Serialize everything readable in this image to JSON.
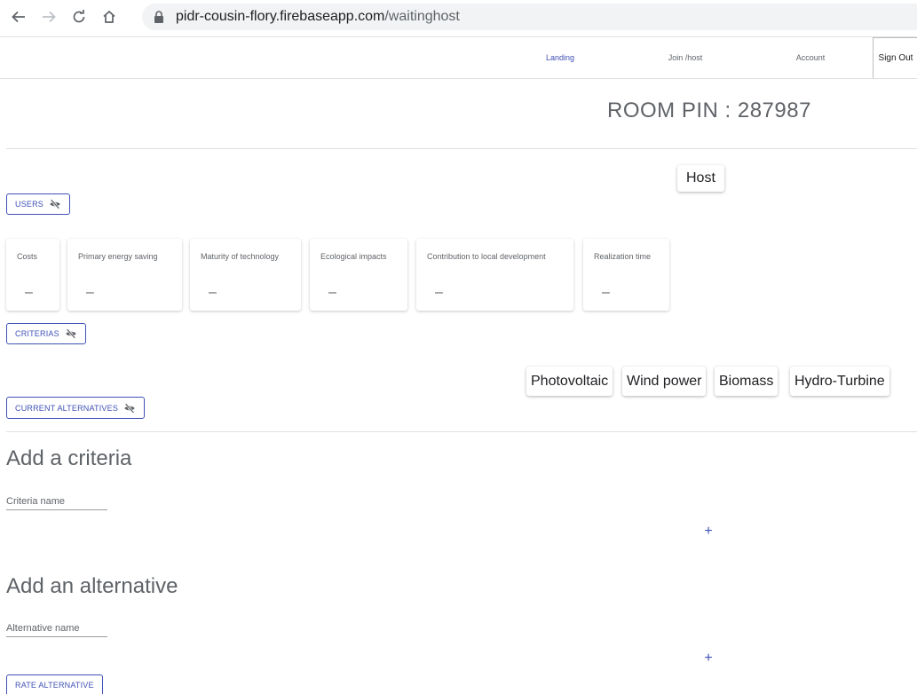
{
  "browser": {
    "url_host": "pidr-cousin-flory.firebaseapp.com",
    "url_path": "/waitinghost"
  },
  "nav": {
    "landing": "Landing",
    "join_host": "Join /host",
    "account": "Account",
    "sign_out": "Sign Out"
  },
  "room_pin": "ROOM PIN : 287987",
  "host_chip": "Host",
  "users_button": "USERS",
  "criteria_cards": [
    {
      "title": "Costs",
      "value": "–"
    },
    {
      "title": "Primary energy saving",
      "value": "–"
    },
    {
      "title": "Maturity of technology",
      "value": "–"
    },
    {
      "title": "Ecological impacts",
      "value": "–"
    },
    {
      "title": "Contribution to local development",
      "value": "–"
    },
    {
      "title": "Realization time",
      "value": "–"
    }
  ],
  "criterias_button": "CRITERIAS",
  "alternatives": [
    "Photovoltaic",
    "Wind power",
    "Biomass",
    "Hydro-Turbine"
  ],
  "current_alternatives_button": "CURRENT ALTERNATIVES",
  "add_criteria": {
    "title": "Add a criteria",
    "placeholder": "Criteria name",
    "add_symbol": "+"
  },
  "add_alternative": {
    "title": "Add an alternative",
    "placeholder": "Alternative name",
    "add_symbol": "+"
  },
  "rate_button": "RATE ALTERNATIVE",
  "colors": {
    "accent": "#3f51b5",
    "text_muted": "#5f6368",
    "divider": "#e0e0e0"
  }
}
